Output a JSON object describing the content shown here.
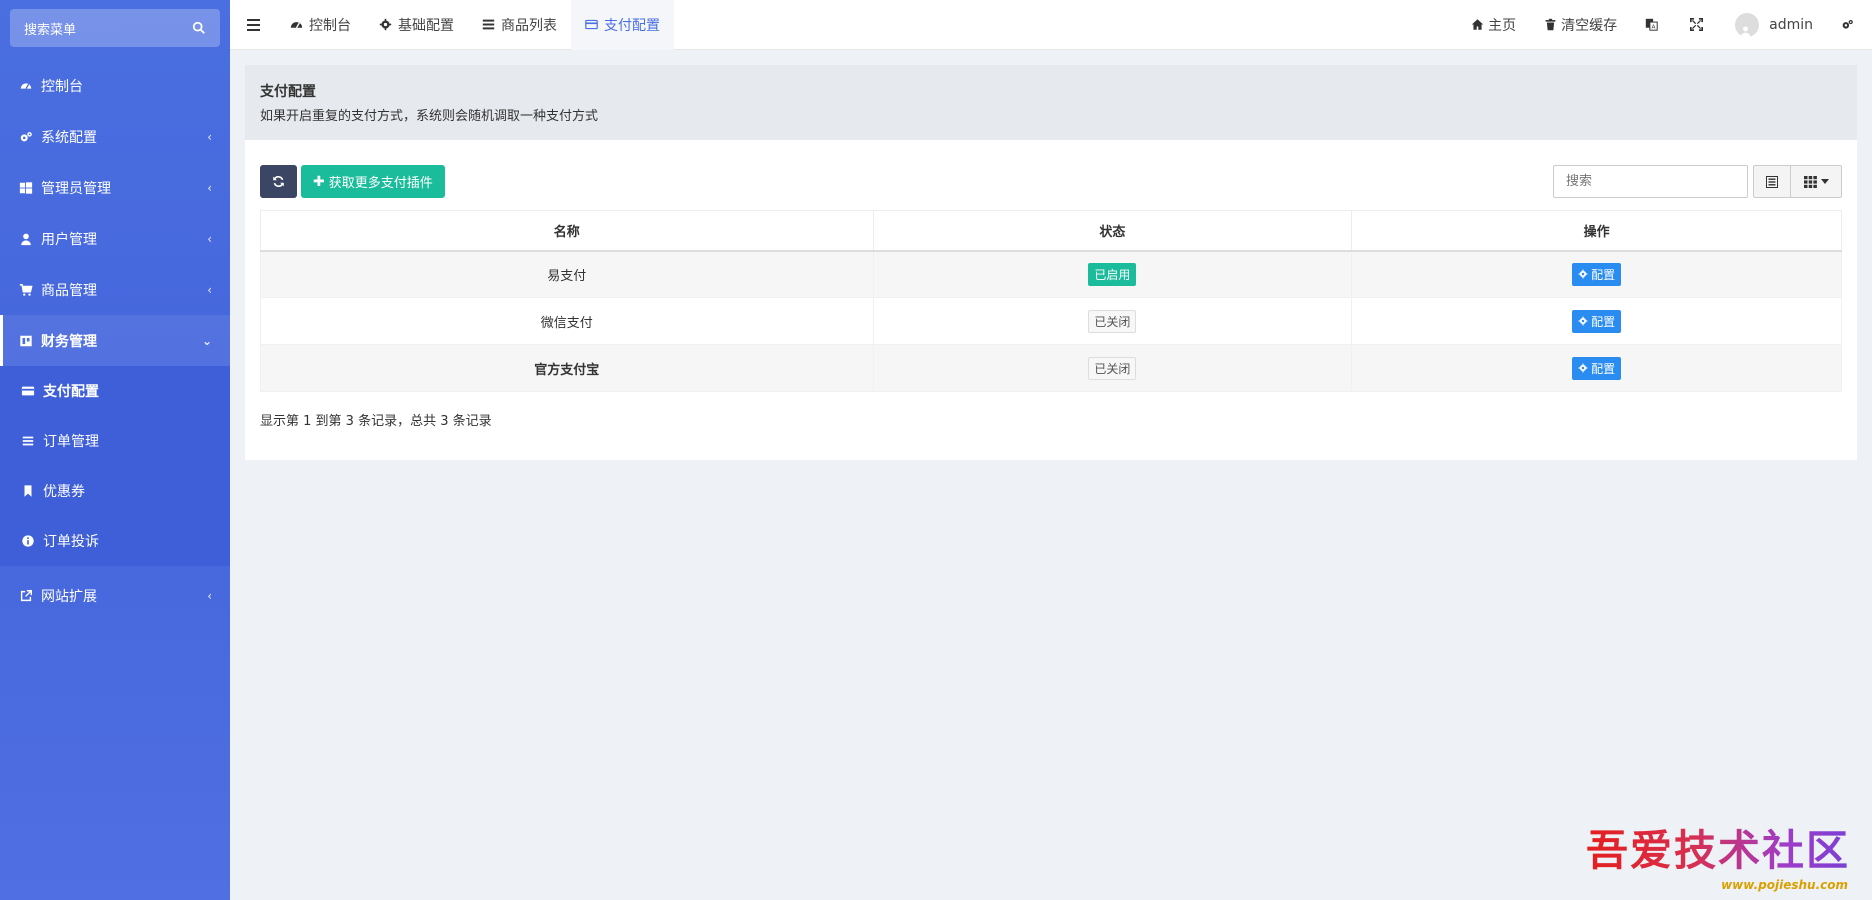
{
  "sidebar": {
    "search_placeholder": "搜索菜单",
    "items": [
      {
        "label": "控制台",
        "icon": "dashboard-icon"
      },
      {
        "label": "系统配置",
        "icon": "cogs-icon",
        "arrow": "‹"
      },
      {
        "label": "管理员管理",
        "icon": "windows-icon",
        "arrow": "‹"
      },
      {
        "label": "用户管理",
        "icon": "user-icon",
        "arrow": "‹"
      },
      {
        "label": "商品管理",
        "icon": "cart-icon",
        "arrow": "‹"
      },
      {
        "label": "财务管理",
        "icon": "ledger-icon",
        "arrow": "⌄"
      }
    ],
    "sub_items": [
      {
        "label": "支付配置",
        "icon": "credit-card-icon"
      },
      {
        "label": "订单管理",
        "icon": "list-icon"
      },
      {
        "label": "优惠券",
        "icon": "bookmark-icon"
      },
      {
        "label": "订单投诉",
        "icon": "info-icon"
      }
    ],
    "ext_item": {
      "label": "网站扩展",
      "icon": "external-link-icon",
      "arrow": "‹"
    }
  },
  "topbar": {
    "tabs": [
      {
        "label": "控制台",
        "icon": "dashboard-icon"
      },
      {
        "label": "基础配置",
        "icon": "gear-icon"
      },
      {
        "label": "商品列表",
        "icon": "list-icon"
      },
      {
        "label": "支付配置",
        "icon": "credit-card-icon"
      }
    ],
    "home_label": "主页",
    "clear_cache_label": "清空缓存",
    "username": "admin"
  },
  "header": {
    "title": "支付配置",
    "subtitle": "如果开启重复的支付方式，系统则会随机调取一种支付方式"
  },
  "toolbar": {
    "more_plugins_label": "获取更多支付插件",
    "search_placeholder": "搜索"
  },
  "table": {
    "columns": [
      "名称",
      "状态",
      "操作"
    ],
    "rows": [
      {
        "name": "易支付",
        "status": "已启用",
        "enabled": true,
        "action": "配置"
      },
      {
        "name": "微信支付",
        "status": "已关闭",
        "enabled": false,
        "action": "配置"
      },
      {
        "name": "官方支付宝",
        "status": "已关闭",
        "enabled": false,
        "action": "配置"
      }
    ]
  },
  "pagination_info": "显示第 1 到第 3 条记录，总共 3 条记录",
  "watermark": {
    "text": "吾爱技术社区",
    "url": "www.pojieshu.com"
  },
  "colors": {
    "sidebar": "#4a6fe0",
    "success": "#1bbc9b",
    "primary": "#2a8cf0",
    "dark": "#3b4664"
  }
}
